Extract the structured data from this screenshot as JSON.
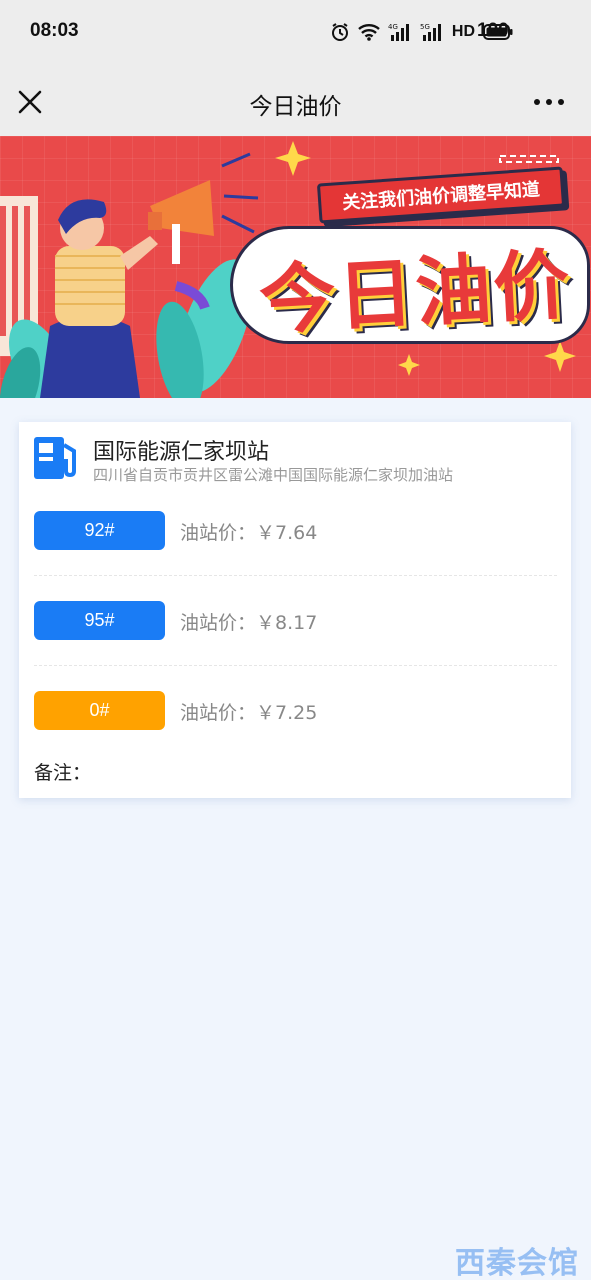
{
  "status_bar": {
    "time": "08:03",
    "battery": "100",
    "network_4g": "4G",
    "network_5g": "5G",
    "hd_label": "HD"
  },
  "nav": {
    "title": "今日油价"
  },
  "banner": {
    "subtitle": "关注我们油价调整早知道",
    "title": "今日油价"
  },
  "station": {
    "name": "国际能源仁家坝站",
    "address": "四川省自贡市贡井区雷公滩中国国际能源仁家坝加油站"
  },
  "fuels": [
    {
      "grade": "92#",
      "price_label": "油站价：￥7.64",
      "color": "#1a7cf5"
    },
    {
      "grade": "95#",
      "price_label": "油站价：￥8.17",
      "color": "#1a7cf5"
    },
    {
      "grade": "0#",
      "price_label": "油站价：￥7.25",
      "color": "#ffa200"
    }
  ],
  "remark": {
    "label": "备注："
  },
  "watermark": "西秦会馆",
  "colors": {
    "accent": "#1a7cf5",
    "diesel": "#ffa200",
    "banner_red": "#e94a4a",
    "page_bg": "#f0f5fd"
  }
}
